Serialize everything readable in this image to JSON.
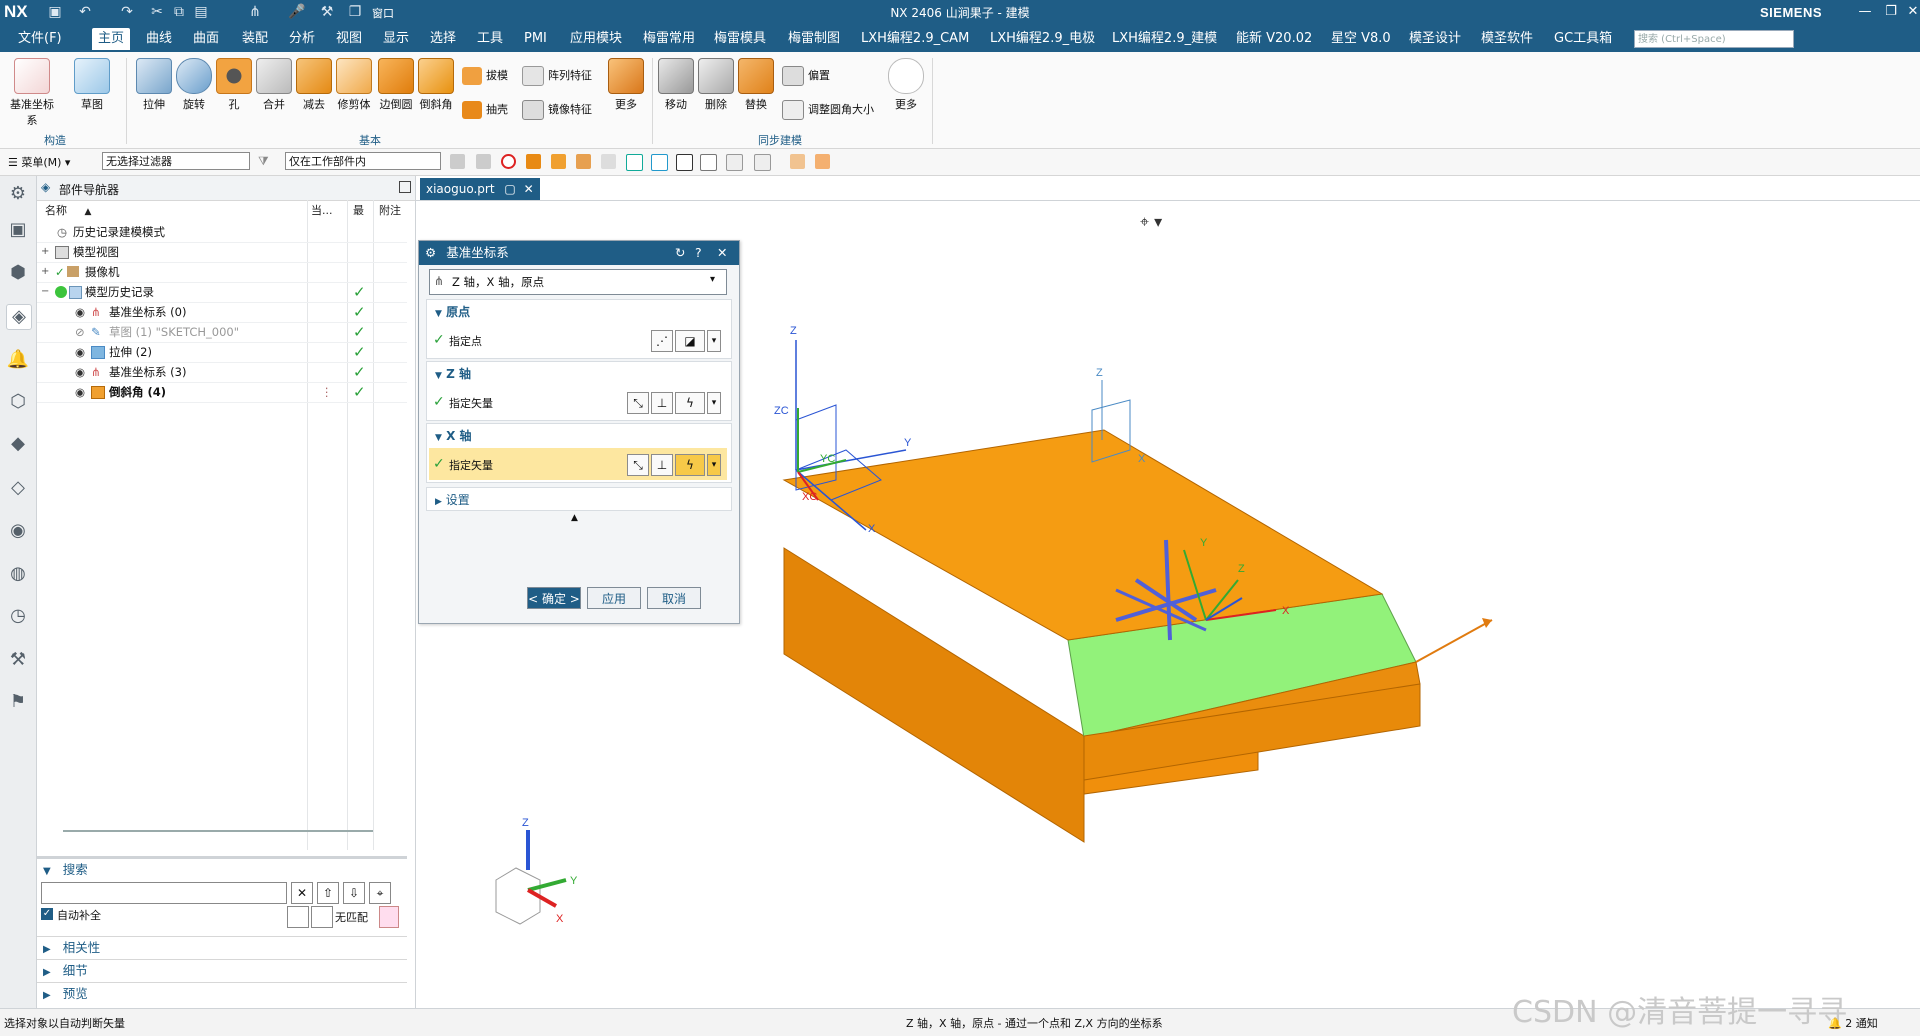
{
  "titlebar": {
    "logo": "NX",
    "title": "NX 2406 山涧果子 - 建模",
    "brand": "SIEMENS",
    "window_menu": "窗口"
  },
  "menubar": {
    "items": [
      "文件(F)",
      "主页",
      "曲线",
      "曲面",
      "装配",
      "分析",
      "视图",
      "显示",
      "选择",
      "工具",
      "PMI",
      "应用模块",
      "梅雷常用",
      "梅雷模具",
      "梅雷制图",
      "LXH编程2.9_CAM",
      "LXH编程2.9_电极",
      "LXH编程2.9_建模",
      "能新 V20.02",
      "星空 V8.0",
      "模圣设计",
      "模圣软件",
      "GC工具箱"
    ],
    "active_index": 1,
    "search_placeholder": "搜索 (Ctrl+Space)"
  },
  "ribbon": {
    "construct": {
      "label": "构造",
      "buttons": [
        "基准坐标系",
        "草图"
      ]
    },
    "basic": {
      "label": "基本",
      "buttons": [
        "拉伸",
        "旋转",
        "孔",
        "合并",
        "减去",
        "修剪体",
        "边倒圆",
        "倒斜角"
      ],
      "small": [
        "拔模",
        "阵列特征",
        "抽壳",
        "镜像特征"
      ],
      "more": "更多"
    },
    "sync": {
      "label": "同步建模",
      "buttons": [
        "移动",
        "删除",
        "替换"
      ],
      "small": [
        "偏置",
        "调整圆角大小"
      ],
      "more": "更多"
    }
  },
  "toolbar": {
    "menu_label": "菜单(M)",
    "selection_filter": "无选择过滤器",
    "scope": "仅在工作部件内"
  },
  "navigator": {
    "title": "部件导航器",
    "columns": [
      "名称",
      "当...",
      "最",
      "附注"
    ],
    "rows": [
      {
        "label": "历史记录建模模式",
        "indent": 0,
        "check": false
      },
      {
        "label": "模型视图",
        "indent": 0,
        "check": false
      },
      {
        "label": "摄像机",
        "indent": 0,
        "check": false
      },
      {
        "label": "模型历史记录",
        "indent": 0,
        "check": true
      },
      {
        "label": "基准坐标系 (0)",
        "indent": 1,
        "check": true
      },
      {
        "label": "草图 (1) \"SKETCH_000\"",
        "indent": 1,
        "check": true
      },
      {
        "label": "拉伸 (2)",
        "indent": 1,
        "check": true
      },
      {
        "label": "基准坐标系 (3)",
        "indent": 1,
        "check": true
      },
      {
        "label": "倒斜角 (4)",
        "indent": 1,
        "check": true
      }
    ],
    "search": {
      "label": "搜索",
      "auto_complete": "自动补全",
      "no_match": "无匹配"
    },
    "panels": [
      "相关性",
      "细节",
      "预览"
    ]
  },
  "tab": {
    "filename": "xiaoguo.prt"
  },
  "dialog": {
    "title": "基准坐标系",
    "type": "Z 轴，X 轴，原点",
    "sections": [
      {
        "header": "原点",
        "spec": "指定点"
      },
      {
        "header": "Z 轴",
        "spec": "指定矢量"
      },
      {
        "header": "X 轴",
        "spec": "指定矢量"
      }
    ],
    "settings": "设置",
    "ok": "< 确定 >",
    "apply": "应用",
    "cancel": "取消"
  },
  "viewport": {
    "axis_labels": [
      "Z",
      "ZC",
      "YC",
      "XC",
      "X",
      "Y",
      "Z",
      "X",
      "Y",
      "Z",
      "X",
      "Y",
      "Z",
      "Y",
      "X"
    ],
    "colors": {
      "top": "#f39c12",
      "side": "#e8890c",
      "chamfer": "#8ff07a"
    }
  },
  "status": {
    "left": "选择对象以自动判断矢量",
    "center": "Z 轴，X 轴，原点 - 通过一个点和 Z,X 方向的坐标系",
    "watermark": "CSDN @清音菩提一寻寻",
    "notify": "2 通知"
  }
}
